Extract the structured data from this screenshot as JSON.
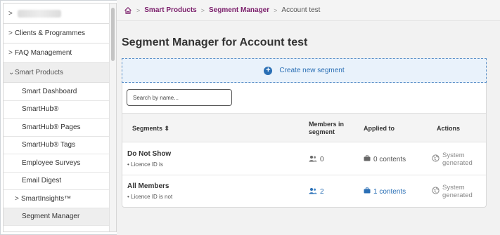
{
  "sidebar": {
    "items": [
      {
        "label": "",
        "chevron": ">",
        "redacted": true
      },
      {
        "label": "Clients & Programmes",
        "chevron": ">"
      },
      {
        "label": "FAQ Management",
        "chevron": ">"
      },
      {
        "label": "Smart Products",
        "chevron": "⌄",
        "open": true
      },
      {
        "label": "Smart Dashboard"
      },
      {
        "label": "SmartHub®"
      },
      {
        "label": "SmartHub® Pages"
      },
      {
        "label": "SmartHub® Tags"
      },
      {
        "label": "Employee Surveys"
      },
      {
        "label": "Email Digest"
      },
      {
        "label": "SmartInsights™",
        "chevron": ">"
      },
      {
        "label": "Segment Manager",
        "active": true
      }
    ]
  },
  "breadcrumb": {
    "items": [
      "Smart Products",
      "Segment Manager"
    ],
    "current": "Account test"
  },
  "page": {
    "title": "Segment Manager for Account test",
    "create_label": "Create new segment",
    "search_placeholder": "Search by name..."
  },
  "table": {
    "headers": {
      "segments": "Segments ⇕",
      "members": "Members in segment",
      "applied": "Applied to",
      "actions": "Actions"
    },
    "rows": [
      {
        "name": "Do Not Show",
        "rule": "• Licence ID is",
        "members": "0",
        "applied": "0 contents",
        "action": "System generated"
      },
      {
        "name": "All Members",
        "rule": "• Licence ID is not",
        "members": "2",
        "applied": "1 contents",
        "action": "System generated"
      }
    ]
  },
  "colors": {
    "accent": "#7b1e6b",
    "link": "#2a6fb5"
  }
}
